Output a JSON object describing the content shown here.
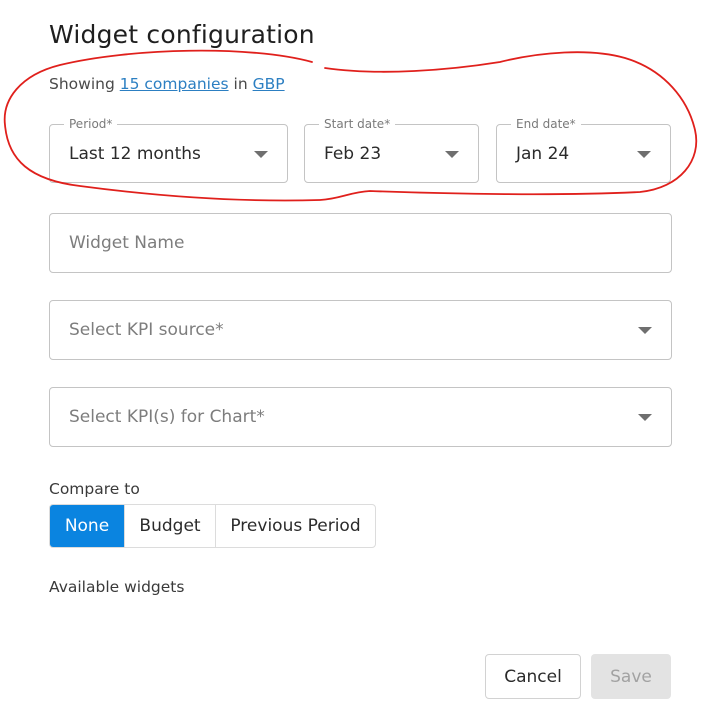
{
  "title": "Widget configuration",
  "scope": {
    "prefix": "Showing",
    "companies_link": "15 companies",
    "connector": "in",
    "currency_link": "GBP"
  },
  "period": {
    "label": "Period*",
    "value": "Last 12 months"
  },
  "start_date": {
    "label": "Start date*",
    "value": "Feb 23"
  },
  "end_date": {
    "label": "End date*",
    "value": "Jan 24"
  },
  "widget_name": {
    "placeholder": "Widget Name"
  },
  "kpi_source": {
    "placeholder": "Select KPI source*"
  },
  "kpis_for_chart": {
    "placeholder": "Select KPI(s) for Chart*"
  },
  "compare": {
    "label": "Compare to",
    "options": [
      "None",
      "Budget",
      "Previous Period"
    ],
    "selected": "None"
  },
  "available_widgets_label": "Available widgets",
  "actions": {
    "cancel": "Cancel",
    "save": "Save"
  },
  "colors": {
    "accent": "#0a84e0",
    "link": "#2c7fc2",
    "annotation": "#e0201c"
  }
}
